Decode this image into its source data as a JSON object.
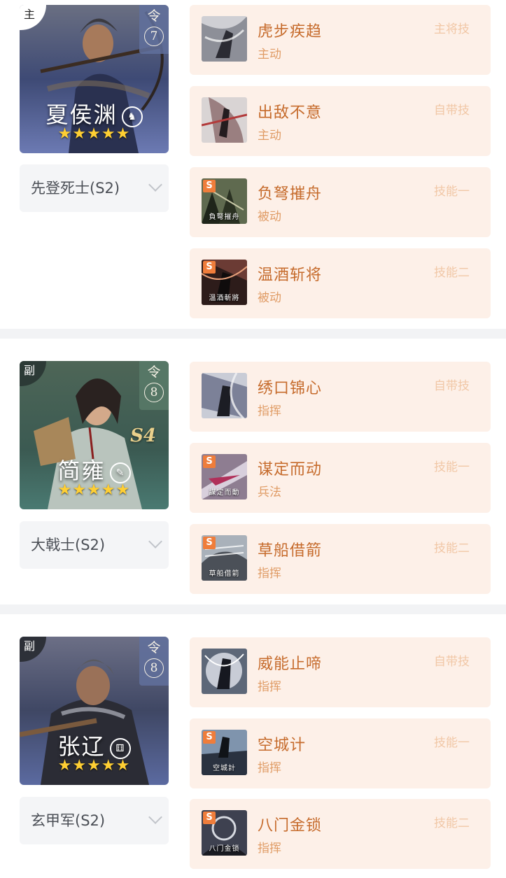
{
  "groups": [
    {
      "role": "主",
      "ling_label": "令",
      "ling_count": "7",
      "hero_name": "夏侯渊",
      "hero_mark": "♞",
      "season": "",
      "stars": 5,
      "troop": "先登死士(S2)",
      "skills": [
        {
          "name": "虎步疾趋",
          "type": "主动",
          "slot": "主将技",
          "s_badge": "",
          "caption": ""
        },
        {
          "name": "出敌不意",
          "type": "主动",
          "slot": "自带技",
          "s_badge": "",
          "caption": ""
        },
        {
          "name": "负弩摧舟",
          "type": "被动",
          "slot": "技能一",
          "s_badge": "S",
          "caption": "負弩摧舟"
        },
        {
          "name": "温酒斩将",
          "type": "被动",
          "slot": "技能二",
          "s_badge": "S",
          "caption": "溫酒斬將"
        }
      ]
    },
    {
      "role": "副",
      "ling_label": "令",
      "ling_count": "8",
      "hero_name": "简雍",
      "hero_mark": "✎",
      "season": "S4",
      "stars": 5,
      "troop": "大戟士(S2)",
      "skills": [
        {
          "name": "绣口锦心",
          "type": "指挥",
          "slot": "自带技",
          "s_badge": "",
          "caption": ""
        },
        {
          "name": "谋定而动",
          "type": "兵法",
          "slot": "技能一",
          "s_badge": "S",
          "caption": "謀定而動"
        },
        {
          "name": "草船借箭",
          "type": "指挥",
          "slot": "技能二",
          "s_badge": "S",
          "caption": "草船借箭"
        }
      ]
    },
    {
      "role": "副",
      "ling_label": "令",
      "ling_count": "8",
      "hero_name": "张辽",
      "hero_mark": "⚅",
      "season": "",
      "stars": 5,
      "troop": "玄甲军(S2)",
      "skills": [
        {
          "name": "威能止啼",
          "type": "指挥",
          "slot": "自带技",
          "s_badge": "",
          "caption": ""
        },
        {
          "name": "空城计",
          "type": "指挥",
          "slot": "技能一",
          "s_badge": "S",
          "caption": "空城計"
        },
        {
          "name": "八门金锁",
          "type": "指挥",
          "slot": "技能二",
          "s_badge": "S",
          "caption": "八门金锁"
        }
      ]
    }
  ],
  "colors": {
    "skill_card_bg": "#fdf0e8",
    "skill_name": "#c66b2c",
    "skill_type": "#e09c66",
    "slot_label": "#f1c7a6",
    "star": "#ffcf33",
    "s_badge": "#ef7d3b"
  },
  "icons": [
    "chevron-down-icon",
    "star-icon",
    "s-badge-icon"
  ]
}
